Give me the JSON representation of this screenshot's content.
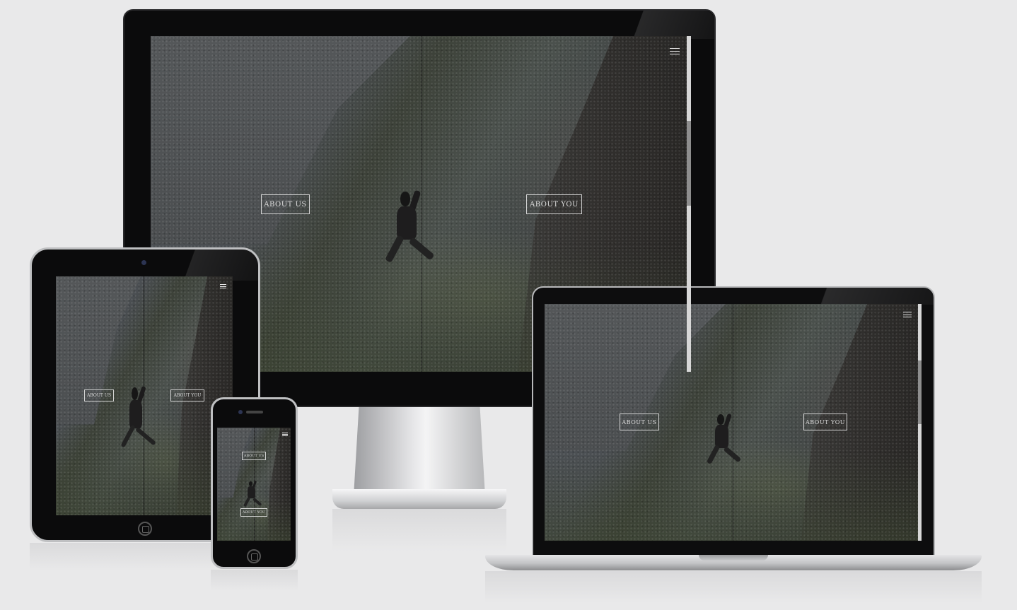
{
  "nav": {
    "about_us_label": "ABOUT US",
    "about_you_label": "ABOUT YOU"
  },
  "icons": {
    "menu": "hamburger-menu-icon",
    "home": "home-button-icon"
  },
  "colors": {
    "background": "#e9e9ea",
    "bezel": "#0b0b0c",
    "button_border": "#ebebeb",
    "button_text": "#dcdcdc"
  }
}
